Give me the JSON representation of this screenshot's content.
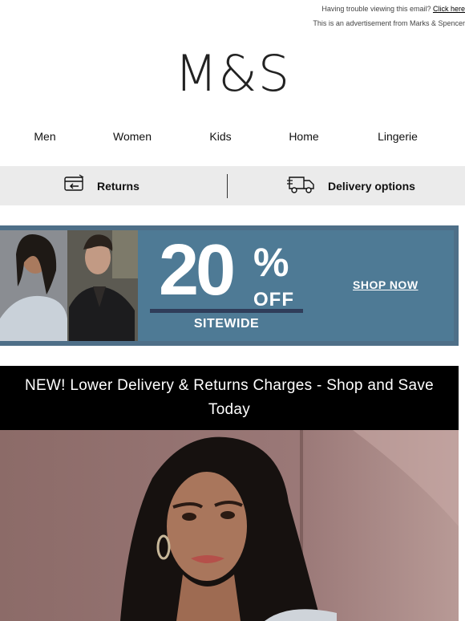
{
  "preheader": {
    "trouble_text": "Having trouble viewing this email? ",
    "trouble_link": "Click here",
    "advert_text": "This is an advertisement from Marks & Spencer"
  },
  "logo": {
    "text": "M&S"
  },
  "nav": {
    "items": [
      {
        "label": "Men"
      },
      {
        "label": "Women"
      },
      {
        "label": "Kids"
      },
      {
        "label": "Home"
      },
      {
        "label": "Lingerie"
      }
    ]
  },
  "services": {
    "returns": {
      "label": "Returns",
      "icon": "returns-card-icon"
    },
    "delivery": {
      "label": "Delivery options",
      "icon": "delivery-truck-icon"
    }
  },
  "promo": {
    "number": "20",
    "percent": "%",
    "off": "OFF",
    "sitewide": "SITEWIDE",
    "cta": "SHOP NOW",
    "background_color": "#4e7a95"
  },
  "banner": {
    "text": "NEW! Lower Delivery & Returns Charges - Shop and Save Today"
  },
  "colors": {
    "service_bar": "#ebebeb",
    "promo_border": "#4e6f88",
    "banner_bg": "#000000"
  }
}
